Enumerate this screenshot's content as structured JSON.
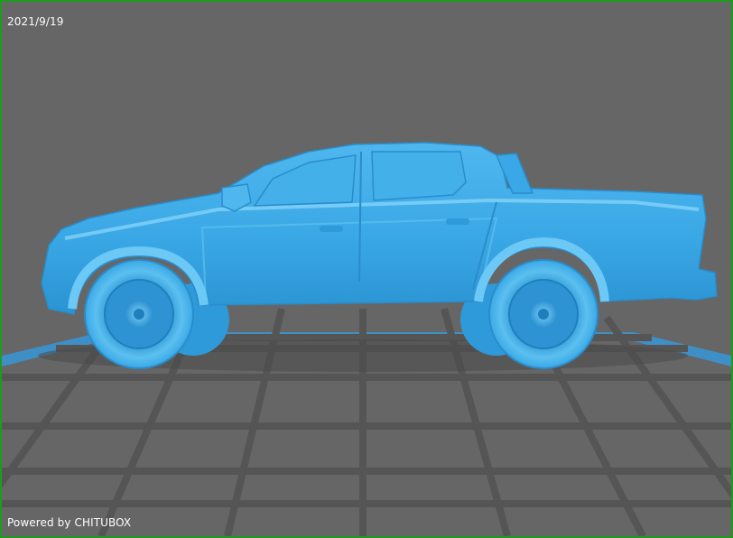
{
  "viewport": {
    "date": "2021/9/19",
    "powered_by": "Powered by CHITUBOX",
    "colors": {
      "background": "#666666",
      "frame_border": "#1e9b1e",
      "grid_line": "#555555",
      "build_plate_edge": "#3f8fc7",
      "model_fill": "#3aa8e6",
      "model_light": "#7fd0f7",
      "model_dark": "#1f7fbd"
    },
    "model": {
      "name": "pickup-truck",
      "view": "side"
    }
  }
}
